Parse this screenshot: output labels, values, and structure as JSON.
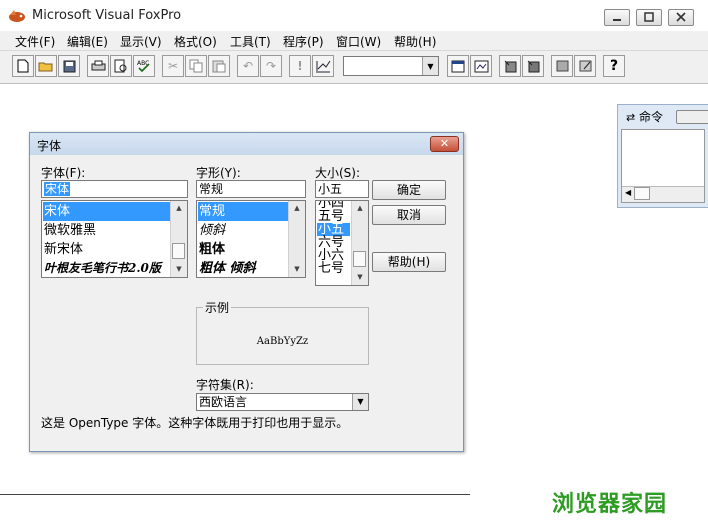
{
  "window": {
    "title": "Microsoft Visual FoxPro"
  },
  "menu": [
    "文件(F)",
    "编辑(E)",
    "显示(V)",
    "格式(O)",
    "工具(T)",
    "程序(P)",
    "窗口(W)",
    "帮助(H)"
  ],
  "command_window": {
    "title": "命令"
  },
  "dialog": {
    "title": "字体",
    "font_label": "字体(F):",
    "font_value": "宋体",
    "font_list": [
      "宋体",
      "微软雅黑",
      "新宋体",
      "叶根友毛笔行书2.0版"
    ],
    "style_label": "字形(Y):",
    "style_value": "常规",
    "style_list": [
      "常规",
      "倾斜",
      "粗体",
      "粗体 倾斜"
    ],
    "size_label": "大小(S):",
    "size_value": "小五",
    "size_list": [
      "小四",
      "五号",
      "小五",
      "六号",
      "小六",
      "七号"
    ],
    "ok_label": "确定",
    "cancel_label": "取消",
    "help_label": "帮助(H)",
    "sample_label": "示例",
    "sample_text": "AaBbYyZz",
    "charset_label": "字符集(R):",
    "charset_value": "西欧语言",
    "description": "这是 OpenType 字体。这种字体既用于打印也用于显示。"
  },
  "watermark": "浏览器家园",
  "colors": {
    "selection": "#3399ff",
    "watermark": "#2e9c22"
  }
}
